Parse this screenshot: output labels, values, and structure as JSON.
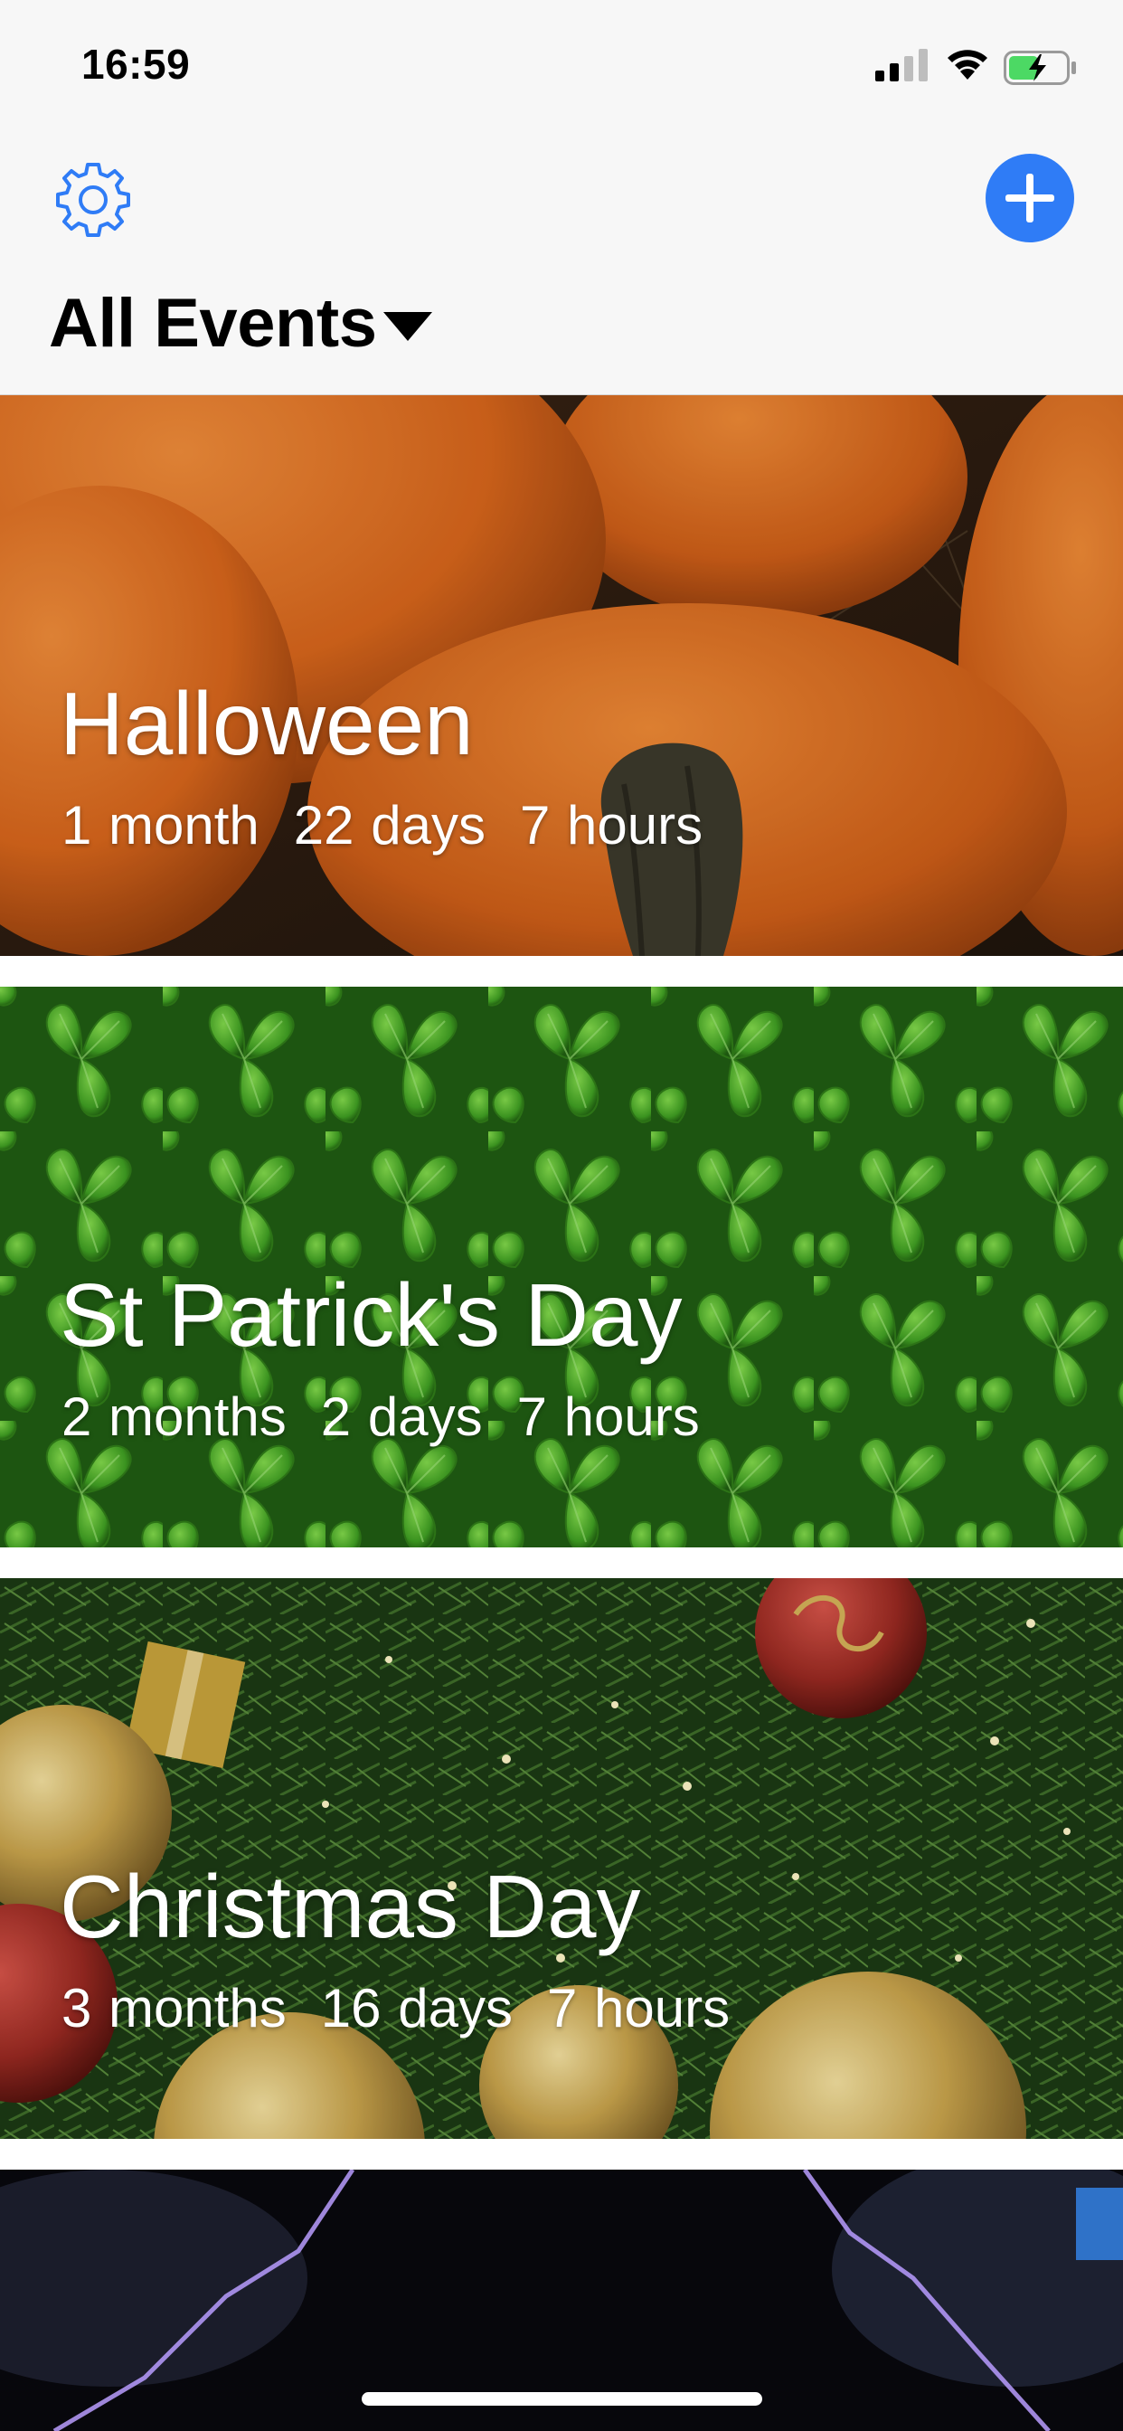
{
  "status_bar": {
    "time": "16:59",
    "icons": [
      "cellular-signal-icon",
      "wifi-icon",
      "battery-charging-icon"
    ]
  },
  "nav": {
    "settings_icon": "gear-icon",
    "add_icon": "plus-icon",
    "filter_label": "All Events",
    "filter_icon": "triangle-down-icon",
    "accent_color": "#2f7cf6"
  },
  "events": [
    {
      "title": "Halloween",
      "countdown": [
        "1 month",
        "22 days",
        "7 hours"
      ],
      "image": "pumpkins"
    },
    {
      "title": "St Patrick's Day",
      "countdown": [
        "2 months",
        "2 days",
        "7 hours"
      ],
      "image": "shamrocks"
    },
    {
      "title": "Christmas Day",
      "countdown": [
        "3 months",
        "16 days",
        "7 hours"
      ],
      "image": "christmas-tree-baubles"
    }
  ]
}
